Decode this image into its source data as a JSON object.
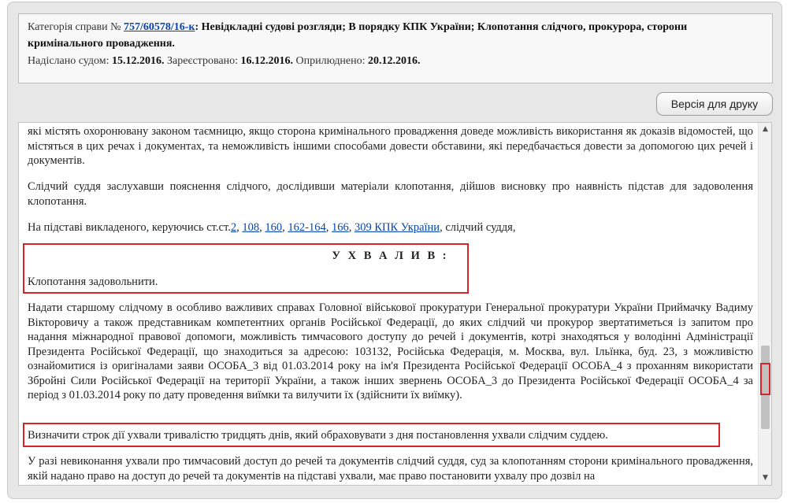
{
  "header": {
    "category_label": "Категорія справи №",
    "case_number": "757/60578/16-к",
    "category_text": ": Невідкладні судові розгляди; В порядку КПК України; Клопотання слідчого, прокурора, сторони",
    "category_text_2": "кримінального провадження.",
    "sent_label": "Надіслано судом:",
    "sent_date": "15.12.2016.",
    "registered_label": "Зареєстровано:",
    "registered_date": "16.12.2016.",
    "published_label": "Оприлюднено:",
    "published_date": "20.12.2016."
  },
  "toolbar": {
    "print_label": "Версія для друку"
  },
  "document": {
    "p1": "які містять охоронювану законом таємницю, якщо сторона кримінального провадження доведе можливість використання як доказів відомостей, що містяться в цих речах і документах, та неможливість іншими способами довести обставини, які передбачається довести за допомогою цих речей і документів.",
    "p2": "Слідчий суддя заслухавши пояснення слідчого, дослідивши матеріали клопотання, дійшов висновку про наявність підстав для задоволення клопотання.",
    "p3_prefix": "На підставі викладеного, керуючись ст.ст.",
    "p3_links": [
      "2",
      "108",
      "160",
      "162-164",
      "166",
      "309 КПК України"
    ],
    "p3_suffix": ", слідчий суддя,",
    "ruling_title": "У Х В А Л И В :",
    "ruling_text": "Клопотання задовольнити.",
    "p4": "Надати старшому слідчому в особливо важливих справах Головної військової прокуратури Генеральної прокуратури України Приймачку Вадиму Вікторовичу а також представникам компетентних органів Російської Федерації, до яких слідчий чи прокурор звертатиметься із запитом про надання міжнародної правової допомоги, можливість тимчасового доступу до речей і документів, котрі знаходяться у володінні Адміністрації Президента Російської Федерації, що знаходиться за адресою: 103132, Російська Федерація, м. Москва, вул. Ільїнка, буд. 23, з можливістю ознайомитися із оригіналами заяви ОСОБА_3 від 01.03.2014 року на ім'я Президента Російської Федерації ОСОБА_4 з проханням використати Збройні Сили Російської Федерації на території України, а також інших звернень ОСОБА_3 до Президента Російської Федерації ОСОБА_4 за період з 01.03.2014 року по дату проведення виїмки та вилучити їх (здійснити їх виїмку).",
    "p5": "Визначити строк дії ухвали тривалістю тридцять днів, який обраховувати з дня постановлення ухвали слідчим суддею.",
    "p6": "У разі невиконання ухвали про тимчасовий доступ до речей та документів слідчий суддя, суд за клопотанням сторони кримінального провадження, якій надано право на доступ до речей та документів на підставі ухвали, має право постановити ухвалу про дозвіл на"
  },
  "colors": {
    "highlight": "#d8232a",
    "link": "#0645ad"
  }
}
